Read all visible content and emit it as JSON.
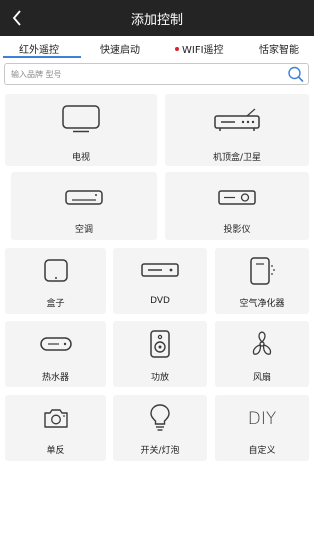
{
  "header": {
    "title": "添加控制",
    "back_icon": "chevron-left-icon"
  },
  "tabs": [
    {
      "label": "红外遥控",
      "active": true
    },
    {
      "label": "快速启动",
      "active": false
    },
    {
      "label": "WIFI遥控",
      "active": false,
      "dot": true
    },
    {
      "label": "恬家智能",
      "active": false
    }
  ],
  "search": {
    "placeholder": "输入品牌 型号",
    "value": "",
    "icon": "search-icon"
  },
  "devices": [
    {
      "label": "电视",
      "icon": "tv-icon"
    },
    {
      "label": "机顶盒/卫星",
      "icon": "set-top-box-icon"
    },
    {
      "label": "空调",
      "icon": "air-conditioner-icon"
    },
    {
      "label": "投影仪",
      "icon": "projector-icon"
    },
    {
      "label": "盒子",
      "icon": "box-icon"
    },
    {
      "label": "DVD",
      "icon": "dvd-icon"
    },
    {
      "label": "空气净化器",
      "icon": "air-purifier-icon"
    },
    {
      "label": "热水器",
      "icon": "water-heater-icon"
    },
    {
      "label": "功放",
      "icon": "amplifier-icon"
    },
    {
      "label": "风扇",
      "icon": "fan-icon"
    },
    {
      "label": "单反",
      "icon": "camera-icon"
    },
    {
      "label": "开关/灯泡",
      "icon": "light-bulb-icon"
    },
    {
      "label": "自定义",
      "icon": "diy-icon",
      "icon_text": "DIY"
    }
  ],
  "colors": {
    "header_bg": "#242424",
    "accent": "#3c82d8",
    "dot": "#e0202a",
    "card_bg": "#f4f4f4",
    "icon_stroke": "#3a3a3a"
  }
}
